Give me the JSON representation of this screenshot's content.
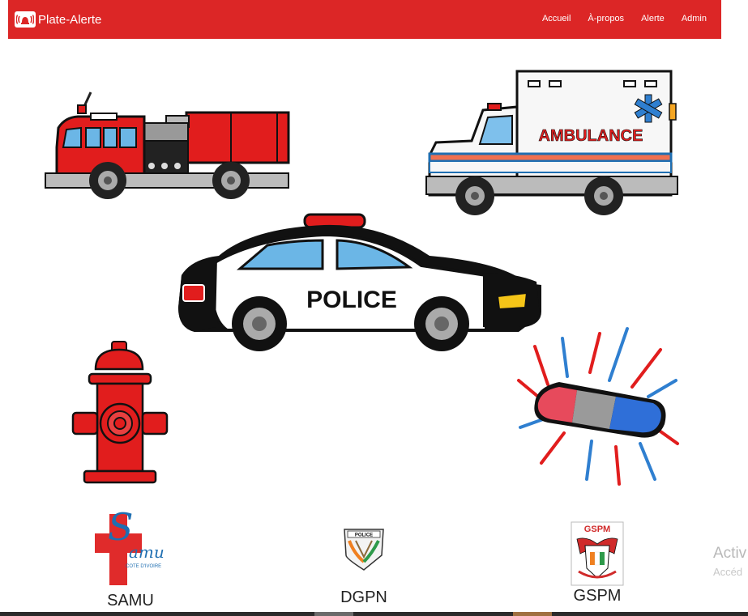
{
  "brand": {
    "name": "Plate-Alerte",
    "icon": "alert-siren-icon"
  },
  "nav": {
    "items": [
      "Accueil",
      "À-propos",
      "Alerte",
      "Admin"
    ]
  },
  "illustrations": {
    "fire_truck": "fire-truck",
    "ambulance": {
      "label": "AMBULANCE"
    },
    "police_car": {
      "label": "POLICE"
    },
    "hydrant": "fire-hydrant",
    "siren": "police-siren-light"
  },
  "services": [
    {
      "name": "SAMU",
      "logo_text": "amu",
      "logo_sub": "COTE D'IVOIRE"
    },
    {
      "name": "DGPN",
      "logo_text": "POLICE"
    },
    {
      "name": "GSPM",
      "logo_text": "GSPM"
    }
  ],
  "watermark": {
    "line1": "Activ",
    "line2": "Accéd"
  },
  "colors": {
    "navbar": "#dc2626",
    "white": "#ffffff",
    "red": "#e11d1d",
    "police_black": "#111111",
    "ambulance_blue": "#1f6fb2"
  }
}
